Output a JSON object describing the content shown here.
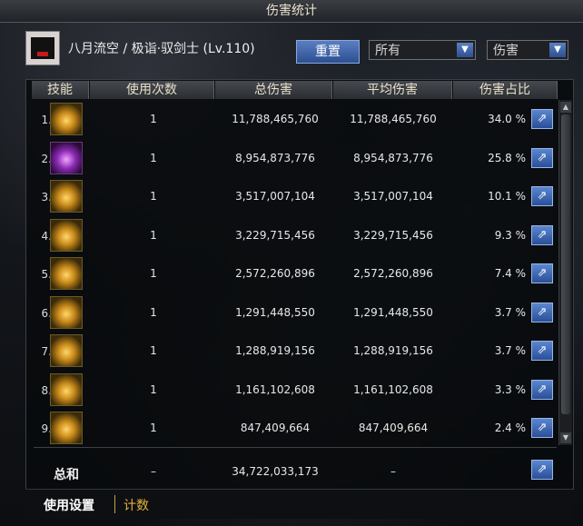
{
  "window": {
    "title": "伤害统计"
  },
  "header": {
    "character": "八月流空 / 极诣·驭剑士 (Lv.110)",
    "reset_label": "重置",
    "filter_1": {
      "value": "所有"
    },
    "filter_2": {
      "value": "伤害"
    }
  },
  "table": {
    "headers": [
      "技能",
      "使用次数",
      "总伤害",
      "平均伤害",
      "伤害占比"
    ],
    "rows": [
      {
        "rank": "1.",
        "icon": "gold-burst-skill-icon",
        "uses": "1",
        "total": "11,788,465,760",
        "avg": "11,788,465,760",
        "pct": "34.0 %"
      },
      {
        "rank": "2.",
        "icon": "purple-swords-skill-icon",
        "uses": "1",
        "total": "8,954,873,776",
        "avg": "8,954,873,776",
        "pct": "25.8 %"
      },
      {
        "rank": "3.",
        "icon": "gold-crown-skill-icon",
        "uses": "1",
        "total": "3,517,007,104",
        "avg": "3,517,007,104",
        "pct": "10.1 %"
      },
      {
        "rank": "4.",
        "icon": "gold-slash-skill-icon",
        "uses": "1",
        "total": "3,229,715,456",
        "avg": "3,229,715,456",
        "pct": "9.3 %"
      },
      {
        "rank": "5.",
        "icon": "gold-strike-skill-icon",
        "uses": "1",
        "total": "2,572,260,896",
        "avg": "2,572,260,896",
        "pct": "7.4 %"
      },
      {
        "rank": "6.",
        "icon": "gold-wave-skill-icon",
        "uses": "1",
        "total": "1,291,448,550",
        "avg": "1,291,448,550",
        "pct": "3.7 %"
      },
      {
        "rank": "7.",
        "icon": "gold-crescent-skill-icon",
        "uses": "1",
        "total": "1,288,919,156",
        "avg": "1,288,919,156",
        "pct": "3.7 %"
      },
      {
        "rank": "8.",
        "icon": "gold-spirit-skill-icon",
        "uses": "1",
        "total": "1,161,102,608",
        "avg": "1,161,102,608",
        "pct": "3.3 %"
      },
      {
        "rank": "9.",
        "icon": "gold-dash-skill-icon",
        "uses": "1",
        "total": "847,409,664",
        "avg": "847,409,664",
        "pct": "2.4 %"
      }
    ],
    "total": {
      "label": "总和",
      "uses": "–",
      "total": "34,722,033,173",
      "avg": "–"
    }
  },
  "footer": {
    "tab_settings": "使用设置",
    "tab_count": "计数"
  },
  "colors": {
    "accent_blue": "#3a66b8",
    "gold": "#e6b33a"
  }
}
